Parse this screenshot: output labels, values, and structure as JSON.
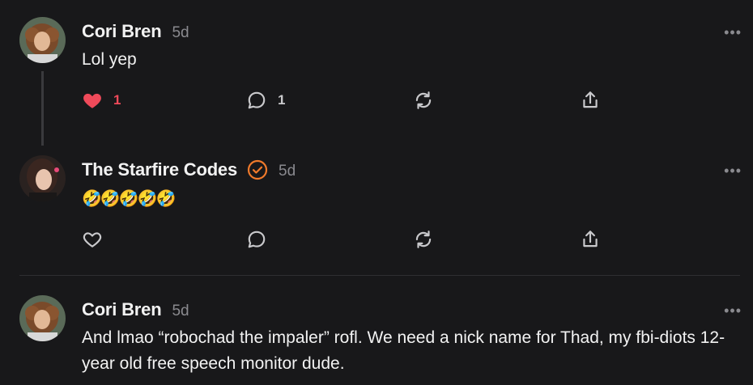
{
  "posts": [
    {
      "author": "Cori Bren",
      "time": "5d",
      "text": "Lol yep",
      "likes": "1",
      "replies": "1",
      "liked": true
    },
    {
      "author": "The Starfire Codes",
      "time": "5d",
      "text": "🤣🤣🤣🤣🤣",
      "verified": true
    },
    {
      "author": "Cori Bren",
      "time": "5d",
      "text": "And lmao “robochad the impaler” rofl. We need a nick name for Thad, my fbi-diots 12-year old free speech monitor dude."
    }
  ],
  "more_label": "•••",
  "colors": {
    "background": "#18181a",
    "heart": "#ef4a5a",
    "verified": "#f07a2b",
    "muted": "#8a8a8f"
  }
}
